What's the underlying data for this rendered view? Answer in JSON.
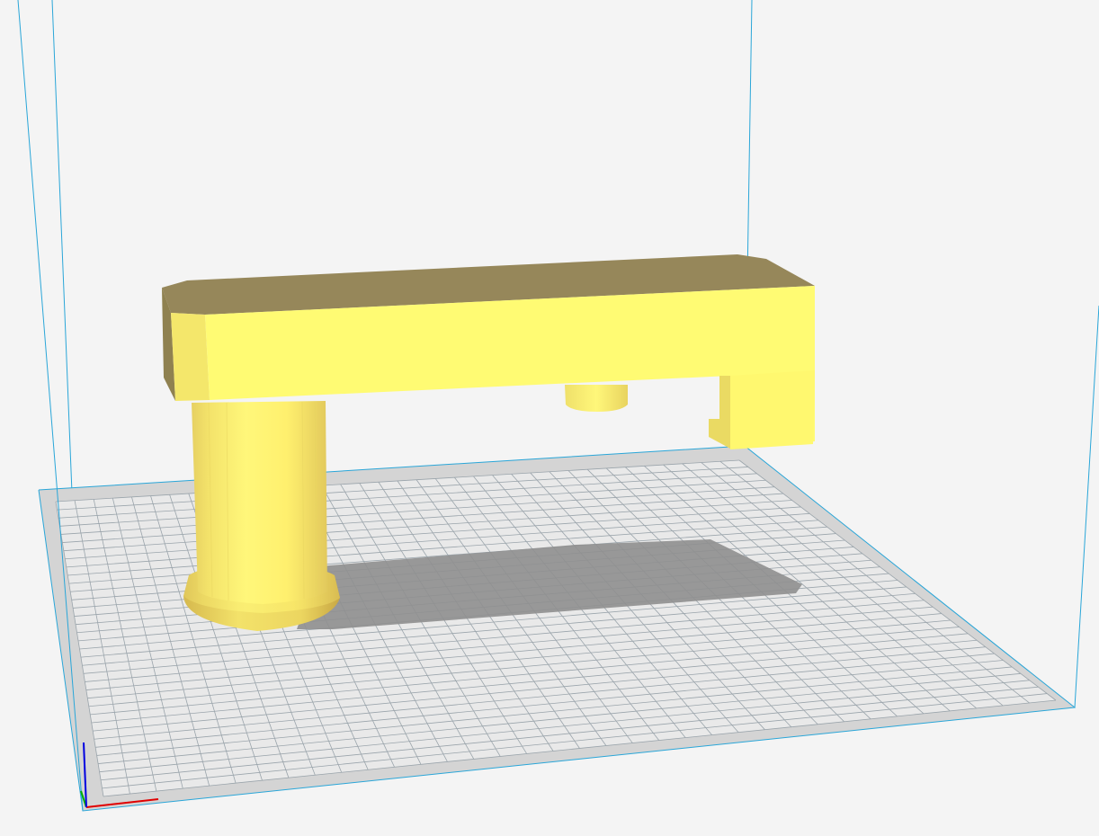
{
  "viewport": {
    "background": "#f4f4f4",
    "volume_line_color": "#2aa6d8",
    "bed_fill": "#e9e9e9",
    "bed_border": "#d4d4d4",
    "grid_color": "#9aa4ab",
    "shadow_color": "#8f8f8f",
    "model_top_color": "#96875a",
    "model_front_color": "#fffb73",
    "axis_x_color": "#e00000",
    "axis_y_color": "#00b000",
    "axis_z_color": "#0000e0"
  }
}
